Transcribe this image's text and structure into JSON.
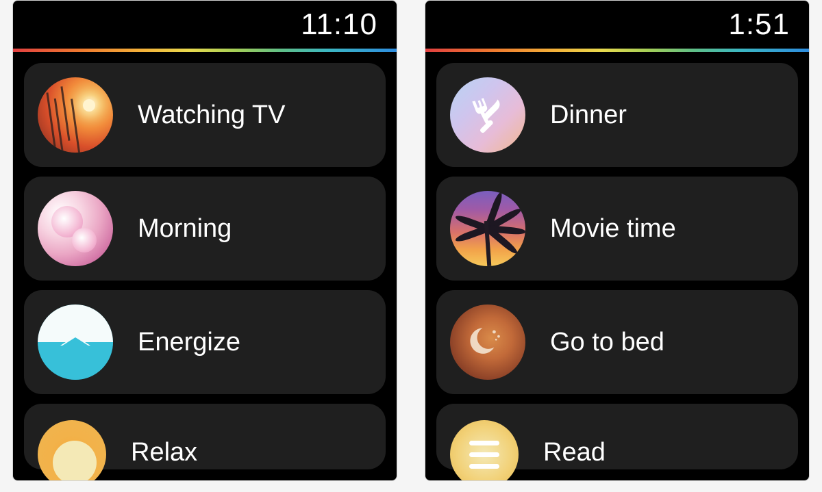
{
  "screens": [
    {
      "time": "11:10",
      "scenes": [
        {
          "label": "Watching TV",
          "icon": "sunset-icon"
        },
        {
          "label": "Morning",
          "icon": "blossom-icon"
        },
        {
          "label": "Energize",
          "icon": "energize-icon"
        },
        {
          "label": "Relax",
          "icon": "relax-icon",
          "cutoff": true
        }
      ]
    },
    {
      "time": "1:51",
      "scenes": [
        {
          "label": "Dinner",
          "icon": "dinner-icon"
        },
        {
          "label": "Movie time",
          "icon": "palm-icon"
        },
        {
          "label": "Go to bed",
          "icon": "moon-icon"
        },
        {
          "label": "Read",
          "icon": "read-icon",
          "cutoff": true
        }
      ]
    }
  ]
}
